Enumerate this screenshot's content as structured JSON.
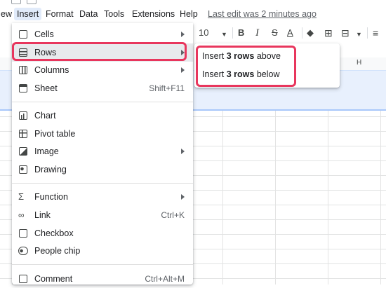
{
  "menubar": {
    "items": [
      "ew",
      "Insert",
      "Format",
      "Data",
      "Tools",
      "Extensions",
      "Help"
    ],
    "last_edit": "Last edit was 2 minutes ago"
  },
  "toolbar": {
    "font_size": "10",
    "bold": "B",
    "italic": "I",
    "strike": "S",
    "text_color": "A"
  },
  "grid": {
    "column_header": "H"
  },
  "insert_menu": {
    "items": [
      {
        "label": "Cells",
        "icon": "cells-icon",
        "submenu": true
      },
      {
        "label": "Rows",
        "icon": "rows-icon",
        "submenu": true
      },
      {
        "label": "Columns",
        "icon": "columns-icon",
        "submenu": true
      },
      {
        "label": "Sheet",
        "icon": "sheet-icon",
        "shortcut": "Shift+F11"
      },
      {
        "label": "Chart",
        "icon": "chart-icon"
      },
      {
        "label": "Pivot table",
        "icon": "pivot-table-icon"
      },
      {
        "label": "Image",
        "icon": "image-icon",
        "submenu": true
      },
      {
        "label": "Drawing",
        "icon": "drawing-icon"
      },
      {
        "label": "Function",
        "icon": "function-icon",
        "submenu": true
      },
      {
        "label": "Link",
        "icon": "link-icon",
        "shortcut": "Ctrl+K"
      },
      {
        "label": "Checkbox",
        "icon": "checkbox-icon"
      },
      {
        "label": "People chip",
        "icon": "people-chip-icon"
      },
      {
        "label": "Comment",
        "icon": "comment-icon",
        "shortcut": "Ctrl+Alt+M"
      }
    ]
  },
  "rows_submenu": {
    "above": {
      "prefix": "Insert ",
      "bold": "3 rows",
      "suffix": " above"
    },
    "below": {
      "prefix": "Insert ",
      "bold": "3 rows",
      "suffix": " below"
    }
  },
  "colors": {
    "highlight_box": "#e8365d",
    "selection": "#e8f0fd",
    "menu_active": "#e1ebfa"
  }
}
